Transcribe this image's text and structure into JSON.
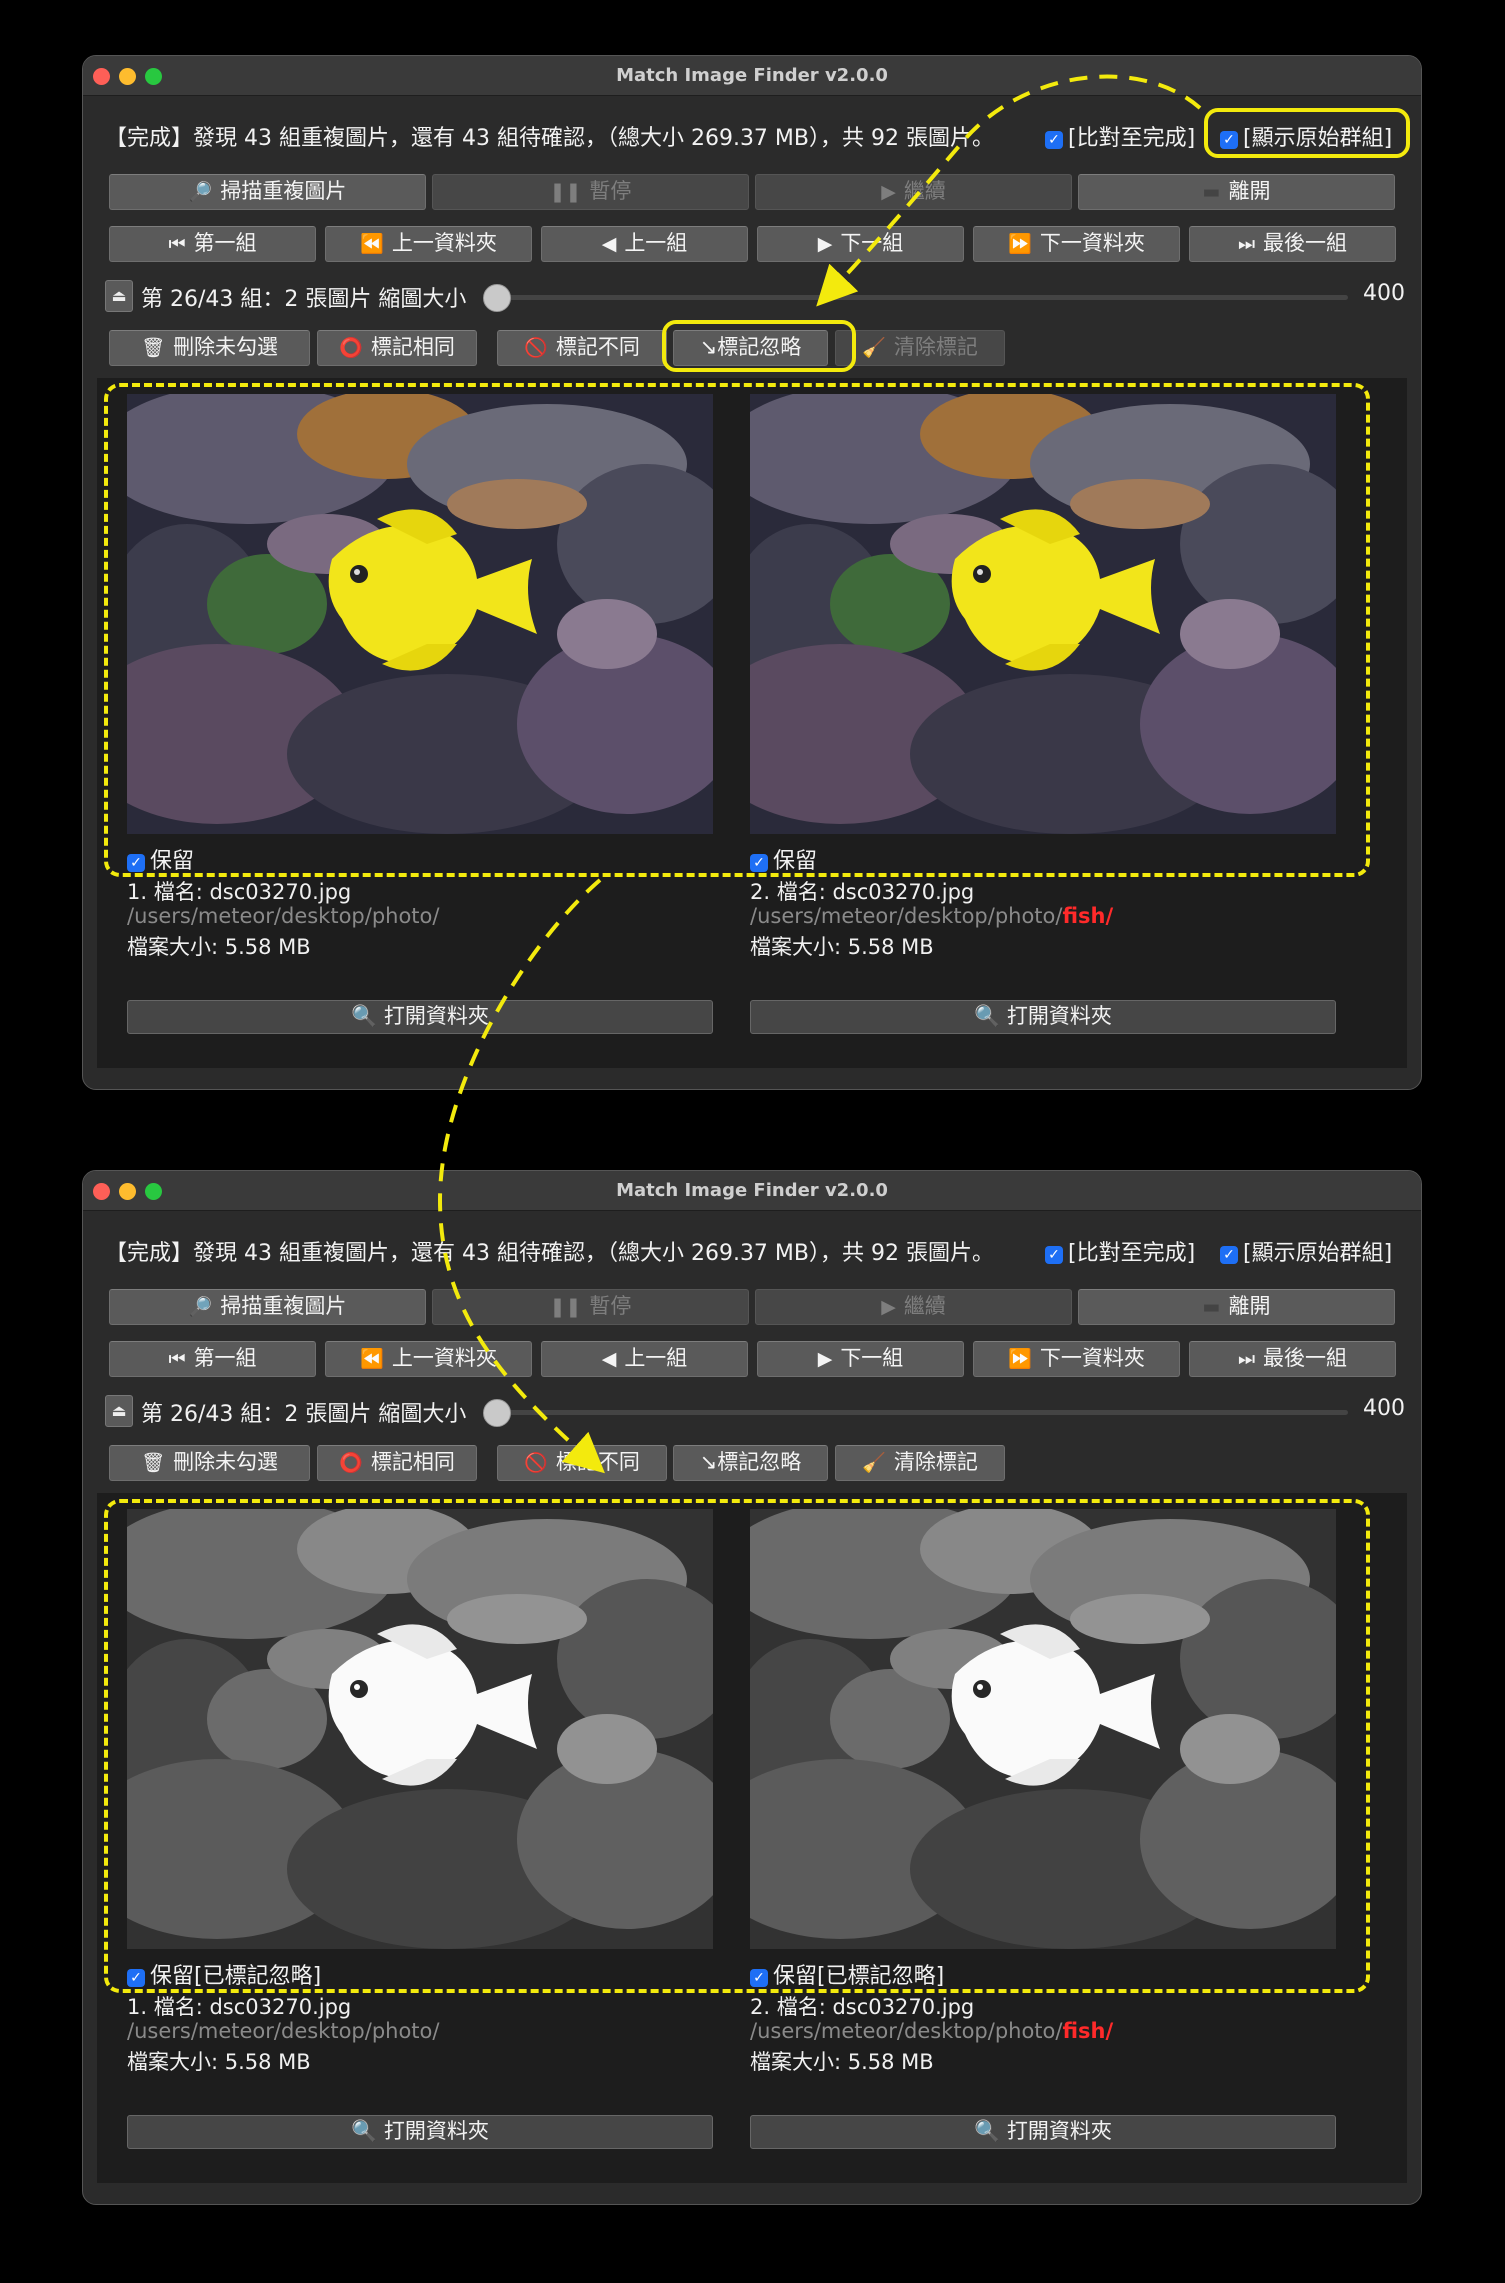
{
  "window_title": "Match Image Finder v2.0.0",
  "status_text": "【完成】發現 43 組重複圖片，還有 43 組待確認，（總大小 269.37 MB），共 92 張圖片。",
  "checkbox_compare_label": "[比對至完成]",
  "checkbox_show_groups_label": "[顯示原始群組]",
  "toolbar": {
    "scan": "掃描重複圖片",
    "pause": "暫停",
    "resume": "繼續",
    "exit": "離開"
  },
  "nav": {
    "first": "第一組",
    "prev_folder": "上一資料夾",
    "prev": "上一組",
    "next": "下一組",
    "next_folder": "下一資料夾",
    "last": "最後一組"
  },
  "group_info": "第 26/43 組：2 張圖片 縮圖大小",
  "zoom_value": "400",
  "actions": {
    "delete_unchecked": "刪除未勾選",
    "mark_same": "標記相同",
    "mark_different": "標記不同",
    "mark_ignore": "↘標記忽略",
    "clear_marks": "清除標記"
  },
  "keep_label": "保留",
  "keep_label_ignored": "保留[已標記忽略]",
  "images": [
    {
      "name": "1. 檔名: dsc03270.jpg",
      "path": "/users/meteor/desktop/photo/",
      "path_highlight": "",
      "size": "檔案大小: 5.58 MB"
    },
    {
      "name": "2. 檔名: dsc03270.jpg",
      "path": "/users/meteor/desktop/photo/",
      "path_highlight": "fish/",
      "size": "檔案大小: 5.58 MB"
    }
  ],
  "open_folder": "打開資料夾",
  "colors": {
    "highlight": "#f3ea0d",
    "checkbox": "#1e6ff5",
    "path_highlight": "#ff2a2a",
    "window_bg": "#2b2b2b"
  },
  "icons": {
    "scan": "magnifier-icon",
    "pause": "pause-icon",
    "resume": "play-icon",
    "exit": "door-icon",
    "first": "skip-first-icon",
    "prev_folder": "rewind-icon",
    "prev": "triangle-left-icon",
    "next": "triangle-right-icon",
    "next_folder": "fast-forward-icon",
    "last": "skip-last-icon",
    "eject": "eject-icon",
    "delete": "trash-icon",
    "same": "red-circle-icon",
    "different": "prohibited-icon",
    "clear": "broom-icon",
    "open": "magnifier-icon"
  }
}
